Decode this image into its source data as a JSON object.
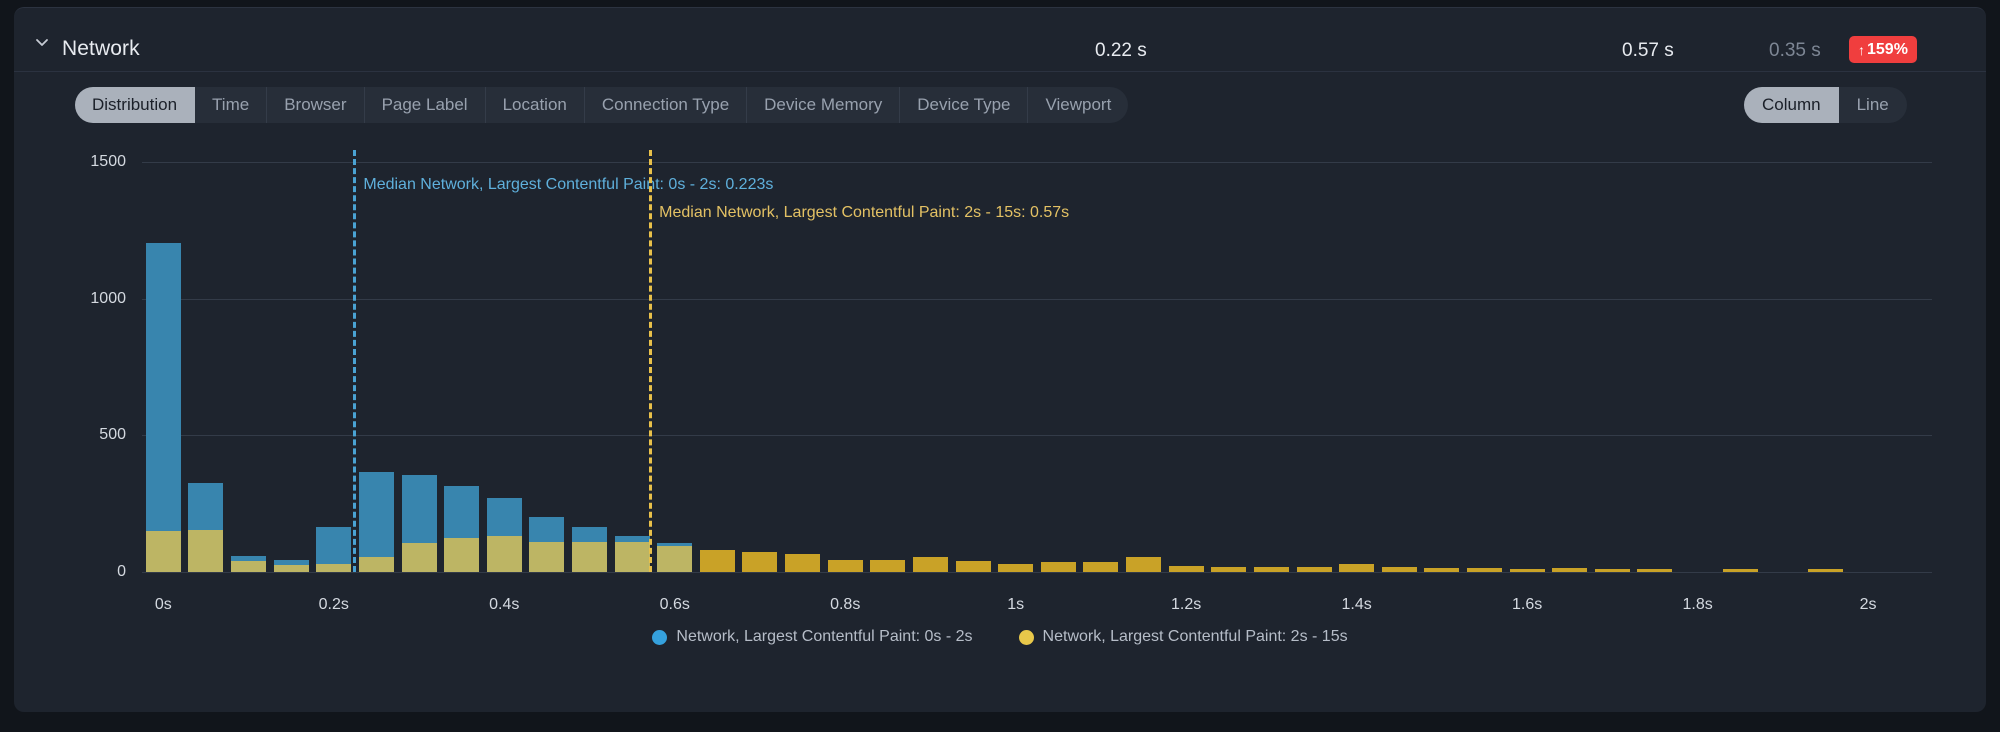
{
  "header": {
    "chevron_icon": "chevron-down-icon",
    "title": "Network",
    "metric_center": "0.22 s",
    "metric_right": "0.57 s",
    "metric_muted": "0.35 s",
    "badge_arrow": "↑",
    "badge_value": "159%",
    "badge_color": "#f03e3e"
  },
  "tabs": [
    {
      "label": "Distribution",
      "active": true
    },
    {
      "label": "Time",
      "active": false
    },
    {
      "label": "Browser",
      "active": false
    },
    {
      "label": "Page Label",
      "active": false
    },
    {
      "label": "Location",
      "active": false
    },
    {
      "label": "Connection Type",
      "active": false
    },
    {
      "label": "Device Memory",
      "active": false
    },
    {
      "label": "Device Type",
      "active": false
    },
    {
      "label": "Viewport",
      "active": false
    }
  ],
  "chart_mode": [
    {
      "label": "Column",
      "active": true
    },
    {
      "label": "Line",
      "active": false
    }
  ],
  "chart_data": {
    "type": "bar",
    "stacked": true,
    "title": "",
    "xlabel": "",
    "ylabel": "",
    "ylim": [
      0,
      1500
    ],
    "yticks": [
      0,
      500,
      1000,
      1500
    ],
    "ytick_labels": [
      "0",
      "500",
      "1000",
      "1500"
    ],
    "xlim": [
      0,
      2.1
    ],
    "xticks": [
      0,
      0.2,
      0.4,
      0.6,
      0.8,
      1.0,
      1.2,
      1.4,
      1.6,
      1.8,
      2.0
    ],
    "xtick_labels": [
      "0s",
      "0.2s",
      "0.4s",
      "0.6s",
      "0.8s",
      "1s",
      "1.2s",
      "1.4s",
      "1.6s",
      "1.8s",
      "2s"
    ],
    "grid": true,
    "legend_position": "bottom",
    "x": [
      0.0,
      0.05,
      0.1,
      0.15,
      0.2,
      0.25,
      0.3,
      0.35,
      0.4,
      0.45,
      0.5,
      0.55,
      0.6,
      0.65,
      0.7,
      0.75,
      0.8,
      0.85,
      0.9,
      0.95,
      1.0,
      1.05,
      1.1,
      1.15,
      1.2,
      1.25,
      1.3,
      1.35,
      1.4,
      1.45,
      1.5,
      1.55,
      1.6,
      1.65,
      1.7,
      1.75,
      1.8,
      1.85,
      1.9,
      1.95,
      2.0
    ],
    "series": [
      {
        "name": "Network, Largest Contentful Paint: 0s - 2s",
        "color": "#3885ae",
        "values": [
          1055,
          170,
          20,
          18,
          135,
          310,
          250,
          190,
          140,
          90,
          55,
          20,
          5,
          0,
          0,
          0,
          0,
          0,
          0,
          0,
          0,
          0,
          0,
          0,
          0,
          0,
          0,
          0,
          0,
          0,
          0,
          0,
          0,
          0,
          0,
          0,
          0,
          0,
          0,
          0,
          0
        ]
      },
      {
        "name": "Network, Largest Contentful Paint: 2s - 15s",
        "color": "#bdb564",
        "values": [
          150,
          155,
          40,
          25,
          30,
          55,
          105,
          125,
          130,
          110,
          110,
          110,
          95,
          80,
          75,
          65,
          45,
          45,
          55,
          40,
          30,
          35,
          35,
          55,
          22,
          20,
          20,
          20,
          30,
          18,
          15,
          15,
          12,
          15,
          10,
          8,
          0,
          6,
          0,
          5,
          0
        ]
      }
    ],
    "annotations": [
      {
        "name": "median-lcp-0s-2s",
        "label": "Median Network, Largest Contentful Paint: 0s - 2s: 0.223s",
        "value": 0.223,
        "color": "#5fb0dc"
      },
      {
        "name": "median-lcp-2s-15s",
        "label": "Median Network, Largest Contentful Paint: 2s - 15s: 0.57s",
        "value": 0.57,
        "color": "#e3c164"
      }
    ]
  },
  "legend": [
    {
      "label": "Network, Largest Contentful Paint: 0s - 2s",
      "color": "#35a1dd"
    },
    {
      "label": "Network, Largest Contentful Paint: 2s - 15s",
      "color": "#e8c84a"
    }
  ]
}
